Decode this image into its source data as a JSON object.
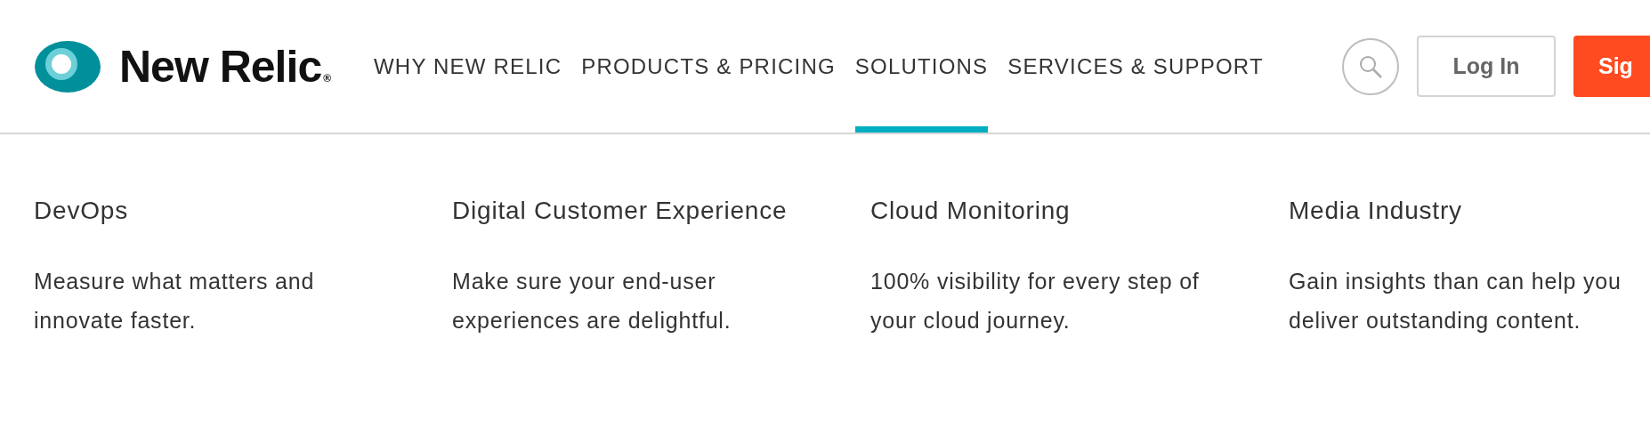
{
  "logo": {
    "name": "New Relic",
    "mark": "®"
  },
  "nav": [
    {
      "label": "WHY NEW RELIC",
      "selected": false
    },
    {
      "label": "PRODUCTS & PRICING",
      "selected": false
    },
    {
      "label": "SOLUTIONS",
      "selected": true
    },
    {
      "label": "SERVICES & SUPPORT",
      "selected": false
    }
  ],
  "buttons": [
    {
      "kind": "search"
    },
    {
      "kind": "outline",
      "label": "Log In"
    },
    {
      "kind": "primary",
      "label": "Sig"
    }
  ],
  "solutions": [
    {
      "title": "DevOps",
      "description": "Measure what matters and innovate faster."
    },
    {
      "title": "Digital Customer Experience",
      "description": "Make sure your end-user experiences are delightful."
    },
    {
      "title": "Cloud Monitoring",
      "description": "100% visibility for every step of your cloud journey."
    },
    {
      "title": "Media Industry",
      "description": "Gain insights than can help you deliver outstanding content."
    }
  ]
}
